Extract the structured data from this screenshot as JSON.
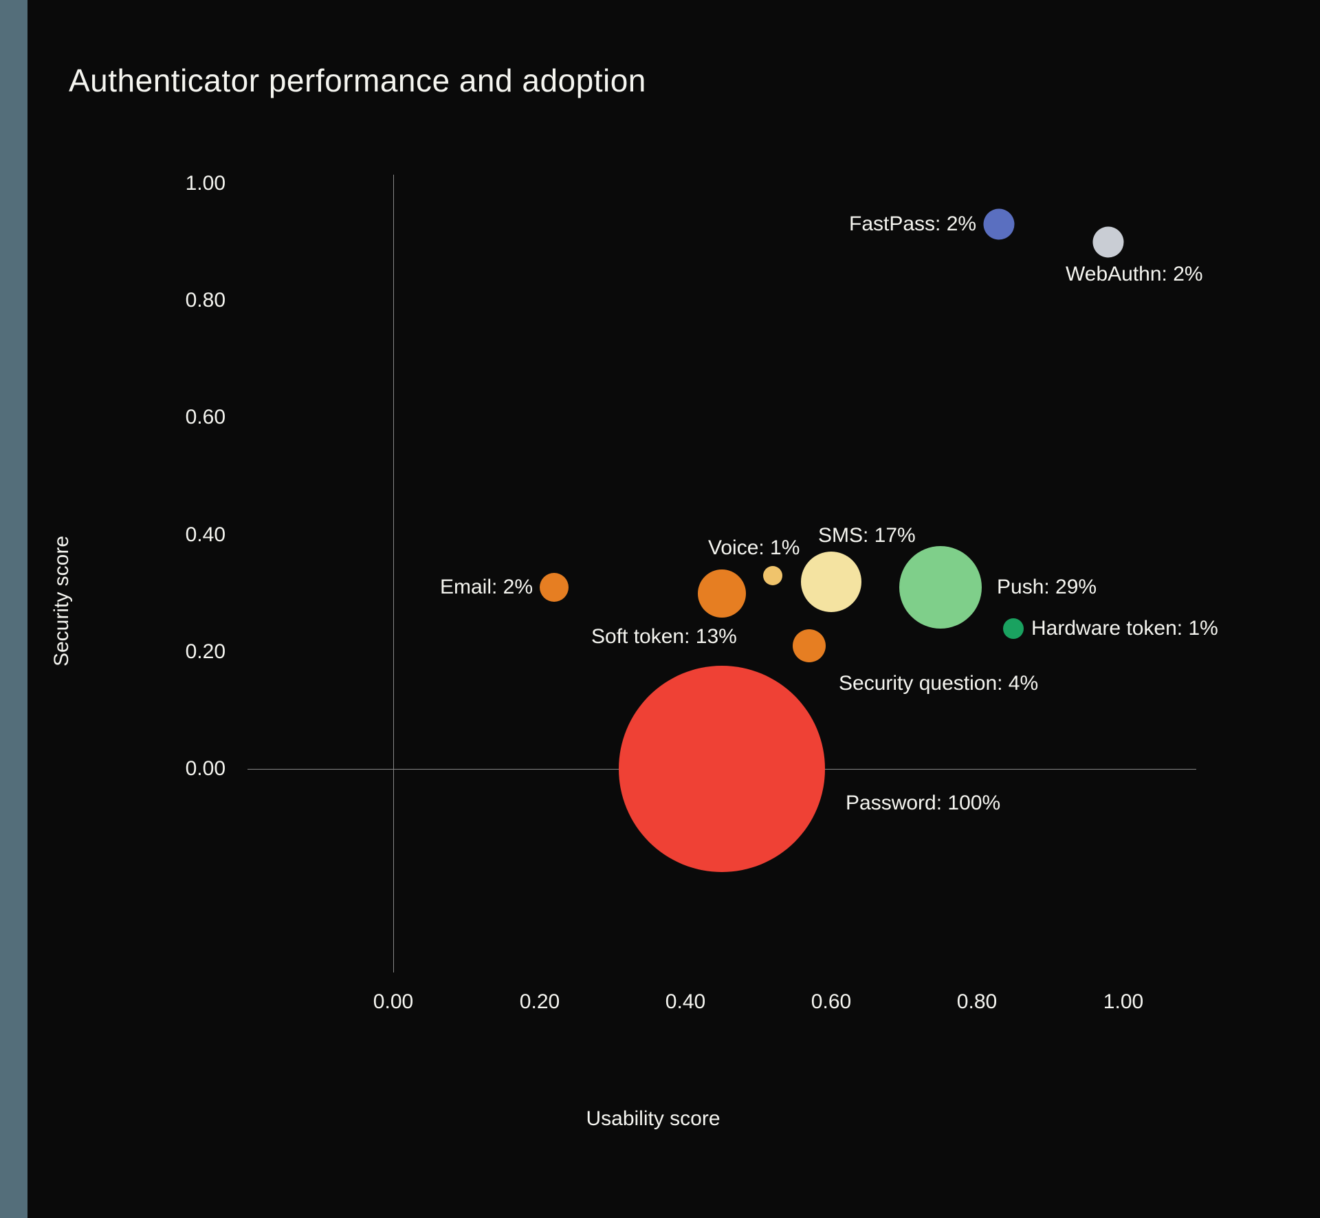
{
  "title": "Authenticator performance and adoption",
  "axes": {
    "xlabel": "Usability score",
    "ylabel": "Security score",
    "xticks": [
      "0.00",
      "0.20",
      "0.40",
      "0.60",
      "0.80",
      "1.00"
    ],
    "yticks": [
      "0.00",
      "0.20",
      "0.40",
      "0.60",
      "0.80",
      "1.00"
    ]
  },
  "chart_data": {
    "type": "scatter",
    "title": "Authenticator performance and adoption",
    "xlabel": "Usability score",
    "ylabel": "Security score",
    "xlim": [
      -0.2,
      1.1
    ],
    "ylim": [
      -0.3,
      1.05
    ],
    "size_encodes": "adoption_percent",
    "series": [
      {
        "name": "Password",
        "x": 0.45,
        "y": 0.0,
        "adoption_percent": 100,
        "color": "#ef4135"
      },
      {
        "name": "Email",
        "x": 0.22,
        "y": 0.31,
        "adoption_percent": 2,
        "color": "#e67e22"
      },
      {
        "name": "Soft token",
        "x": 0.45,
        "y": 0.3,
        "adoption_percent": 13,
        "color": "#e67e22"
      },
      {
        "name": "Voice",
        "x": 0.52,
        "y": 0.33,
        "adoption_percent": 1,
        "color": "#f0c46c"
      },
      {
        "name": "SMS",
        "x": 0.6,
        "y": 0.32,
        "adoption_percent": 17,
        "color": "#f4e3a1"
      },
      {
        "name": "Security question",
        "x": 0.57,
        "y": 0.21,
        "adoption_percent": 4,
        "color": "#e67e22"
      },
      {
        "name": "Push",
        "x": 0.75,
        "y": 0.31,
        "adoption_percent": 29,
        "color": "#7fcf8a"
      },
      {
        "name": "Hardware token",
        "x": 0.85,
        "y": 0.24,
        "adoption_percent": 1,
        "color": "#1aa260"
      },
      {
        "name": "FastPass",
        "x": 0.83,
        "y": 0.93,
        "adoption_percent": 2,
        "color": "#5a6fc0"
      },
      {
        "name": "WebAuthn",
        "x": 0.98,
        "y": 0.9,
        "adoption_percent": 2,
        "color": "#c9cdd4"
      }
    ]
  },
  "labels": {
    "Password": "Password: 100%",
    "Email": "Email: 2%",
    "Soft token": "Soft token: 13%",
    "Voice": "Voice: 1%",
    "SMS": "SMS: 17%",
    "Security question": "Security question: 4%",
    "Push": "Push: 29%",
    "Hardware token": "Hardware token: 1%",
    "FastPass": "FastPass: 2%",
    "WebAuthn": "WebAuthn: 2%"
  }
}
